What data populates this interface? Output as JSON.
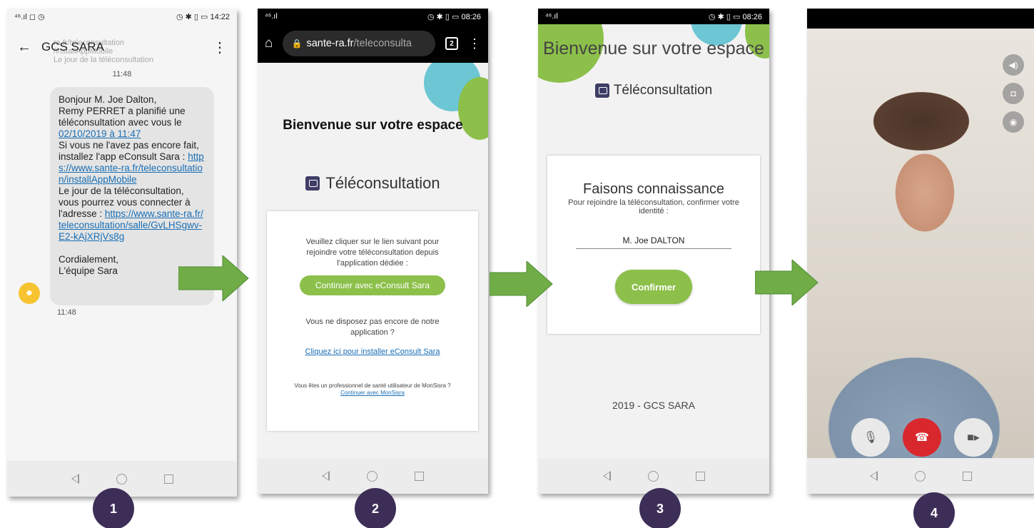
{
  "phone1": {
    "status_left": "⁴⁶.ıl ◻ ◷",
    "status_right": "◷ ✱ ▯ ▭ 14:22",
    "contact": "GCS SARA",
    "ghost_lines": [
      "ra.fr/teleconsultation",
      "/installAppMobile",
      "Le jour de la téléconsultation"
    ],
    "time_top": "11:48",
    "message": "Bonjour M. Joe Dalton,\n Remy PERRET a planifié une téléconsultation avec vous le ",
    "message_date": "02/10/2019 à 11:47",
    "message_mid": "\nSi vous ne l'avez pas encore fait, installez l'app eConsult Sara : ",
    "link_install": "https://www.sante-ra.fr/teleconsultation/installAppMobile",
    "message_day": "\nLe jour de la téléconsultation, vous pourrez vous connecter à l'adresse : ",
    "link_room": "https://www.sante-ra.fr/teleconsultation/salle/GvLHSgwv-E2-kAjXRjVs8g",
    "signoff": "Cordialement,\nL'équipe Sara",
    "time_bottom": "11:48"
  },
  "phone2": {
    "status_left": "⁴⁶.ıl",
    "status_right": "◷ ✱ ▯ ▭ 08:26",
    "url_host": "sante-ra.fr",
    "url_path": "/teleconsulta",
    "tab_count": "2",
    "welcome": "Bienvenue sur votre espace",
    "teleconsultation": "Téléconsultation",
    "instruction": "Veuillez cliquer sur le lien suivant pour rejoindre votre téléconsultation depuis l'application dédiée :",
    "continue_button": "Continuer avec eConsult Sara",
    "no_app": "Vous ne disposez pas encore de notre application ?",
    "install_link": "Cliquez ici pour installer eConsult Sara",
    "pro_text": "Vous êtes un professionnel de santé utilisateur de MonSisra ?",
    "monsisra_link": "Continuer avec MonSisra"
  },
  "phone3": {
    "status_left": "⁴⁶.ıl",
    "status_right": "◷ ✱ ▯ ▭ 08:26",
    "welcome": "Bienvenue sur votre espace",
    "teleconsultation": "Téléconsultation",
    "heading": "Faisons connaissance",
    "subtext": "Pour rejoindre la téléconsultation, confirmer votre identité :",
    "name_value": "M. Joe DALTON",
    "confirm_button": "Confirmer",
    "footer": "2019 - GCS SARA"
  },
  "phone4": {
    "side_icons": [
      "speaker-icon",
      "camera-switch-icon",
      "eye-icon"
    ],
    "controls": [
      "microphone-icon",
      "hang-up-icon",
      "video-camera-icon"
    ]
  },
  "badges": [
    "1",
    "2",
    "3",
    "4"
  ],
  "colors": {
    "accent_green": "#8cc04a",
    "arrow_green": "#70ad47",
    "badge_purple": "#3d2e58",
    "hangup_red": "#d9272e",
    "blob_teal": "#6cc6d3",
    "blob_lime": "#8cc04a"
  }
}
